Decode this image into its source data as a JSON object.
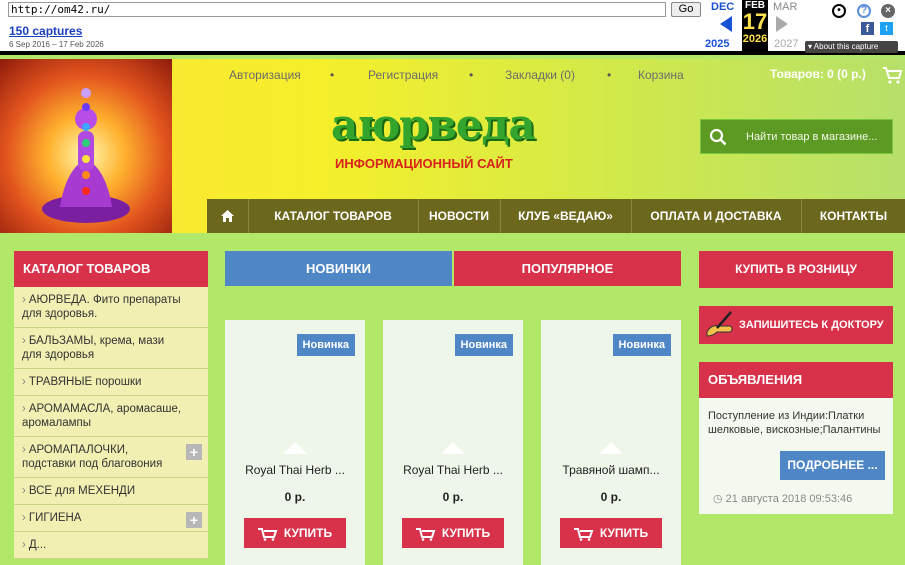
{
  "wayback": {
    "url": "http://om42.ru/",
    "go_label": "Go",
    "captures": "150 captures",
    "date_range": "6 Sep 2016 – 17 Feb 2026",
    "month_prev": "DEC",
    "month_cur": "FEB",
    "month_next": "MAR",
    "day": "17",
    "year_prev": "2025",
    "year_cur": "2026",
    "year_next": "2027",
    "about": "About this capture"
  },
  "header": {
    "links": [
      "Авторизация",
      "Регистрация",
      "Закладки (0)",
      "Корзина"
    ],
    "cart_summary": "Товаров: 0 (0 р.)",
    "logo_text": "аюрведа",
    "logo_subtitle": "ИНФОРМАЦИОННЫЙ САЙТ",
    "search_placeholder": "Найти товар в магазине..."
  },
  "nav": {
    "items": [
      "КАТАЛОГ ТОВАРОВ",
      "НОВОСТИ",
      "КЛУБ «ВЕДАЮ»",
      "ОПЛАТА И ДОСТАВКА",
      "КОНТАКТЫ"
    ]
  },
  "catalog": {
    "title": "КАТАЛОГ ТОВАРОВ",
    "items": [
      "АЮРВЕДА. Фито препараты для здоровья.",
      "БАЛЬЗАМЫ, крема, мази для здоровья",
      "ТРАВЯНЫЕ порошки",
      "АРОМАМАСЛА, аромасаше, аромалампы",
      "АРОМАПАЛОЧКИ, подставки под благовония",
      "ВСЕ для МЕХЕНДИ",
      "ГИГИЕНА",
      "Д..."
    ]
  },
  "tabs": {
    "new": "НОВИНКИ",
    "popular": "ПОПУЛЯРНОЕ"
  },
  "products": [
    {
      "badge": "Новинка",
      "name": "Royal Thai Herb ...",
      "price": "0 р.",
      "buy": "КУПИТЬ"
    },
    {
      "badge": "Новинка",
      "name": "Royal Thai Herb ...",
      "price": "0 р.",
      "buy": "КУПИТЬ"
    },
    {
      "badge": "Новинка",
      "name": "Травяной шамп...",
      "price": "0 р.",
      "buy": "КУПИТЬ"
    }
  ],
  "sidebar": {
    "retail": "КУПИТЬ В РОЗНИЦУ",
    "doctor": "ЗАПИШИТЕСЬ К ДОКТОРУ",
    "ads_title": "ОБЪЯВЛЕНИЯ",
    "ads_text": "Поступление из Индии:Платки шелковые, вискозные;Палантины",
    "ads_more": "ПОДРОБНЕЕ ...",
    "ads_date": "21 августа 2018 09:53:46"
  },
  "colors": {
    "accent_red": "#d8314a",
    "accent_blue": "#4f86c6",
    "nav_olive": "#6b671d",
    "bg_green": "#b2e86a"
  }
}
